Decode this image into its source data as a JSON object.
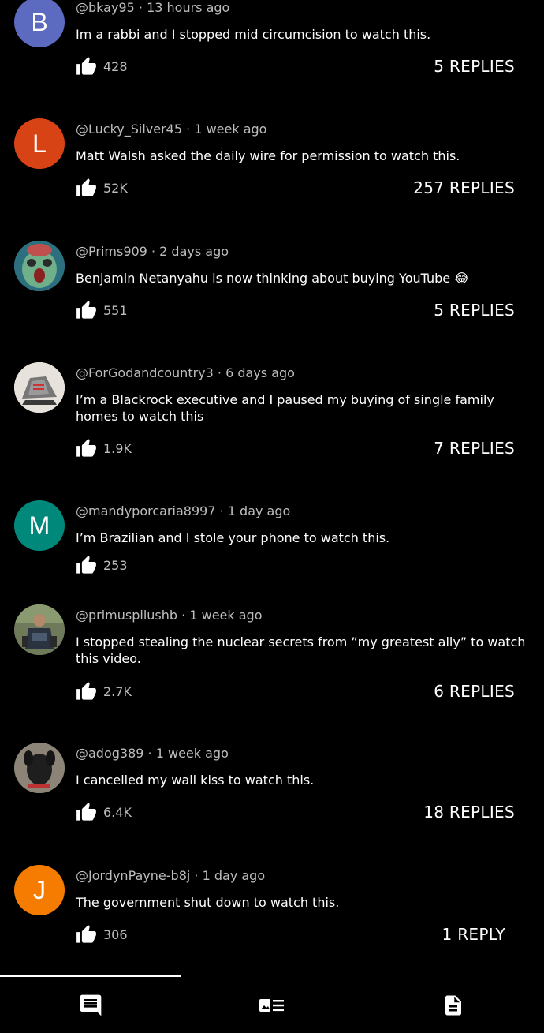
{
  "comments": [
    {
      "avatar_letter": "B",
      "avatar_color": "#5c6bc0",
      "author": "@bkay95",
      "time": "13 hours ago",
      "text": "Im a rabbi and I stopped mid circumcision to watch this.",
      "likes": "428",
      "replies": "5 REPLIES"
    },
    {
      "avatar_letter": "L",
      "avatar_color": "#d84315",
      "author": "@Lucky_Silver45",
      "time": "1 week ago",
      "text": "Matt Walsh asked the daily wire for permission to watch this.",
      "likes": "52K",
      "replies": "257 REPLIES"
    },
    {
      "avatar_letter": "",
      "avatar_color": "#3a7d8c",
      "author": "@Prims909",
      "time": "2 days ago",
      "text": "Benjamin Netanyahu is now thinking about buying YouTube 😂",
      "likes": "551",
      "replies": "5 REPLIES"
    },
    {
      "avatar_letter": "",
      "avatar_color": "#d8d0c8",
      "author": "@ForGodandcountry3",
      "time": "6 days ago",
      "text": "I’m a Blackrock executive and I paused my buying of single family homes to watch this",
      "likes": "1.9K",
      "replies": "7 REPLIES"
    },
    {
      "avatar_letter": "M",
      "avatar_color": "#00897b",
      "author": "@mandyporcaria8997",
      "time": "1 day ago",
      "text": "I’m Brazilian and I stole your phone to watch this.",
      "likes": "253",
      "replies": ""
    },
    {
      "avatar_letter": "",
      "avatar_color": "#4a4a3a",
      "author": "@primuspilushb",
      "time": "1 week ago",
      "text": "I stopped stealing the nuclear secrets from ”my greatest ally” to watch this video.",
      "likes": "2.7K",
      "replies": "6 REPLIES"
    },
    {
      "avatar_letter": "",
      "avatar_color": "#5a5346",
      "author": "@adog389",
      "time": "1 week ago",
      "text": "I cancelled my wall kiss to watch this.",
      "likes": "6.4K",
      "replies": "18 REPLIES"
    },
    {
      "avatar_letter": "J",
      "avatar_color": "#f57c00",
      "author": "@JordynPayne-b8j",
      "time": "1 day ago",
      "text": "The government shut down to watch this.",
      "likes": "306",
      "replies": "1 REPLY"
    }
  ],
  "meta_separator": "·",
  "bottom_nav": {
    "tabs": [
      {
        "icon": "comments-icon",
        "selected": true
      },
      {
        "icon": "description-list-icon",
        "selected": false
      },
      {
        "icon": "document-icon",
        "selected": false
      }
    ]
  },
  "colors": {
    "background": "#000000",
    "meta_text": "#bdbdbd",
    "text": "#ffffff"
  }
}
